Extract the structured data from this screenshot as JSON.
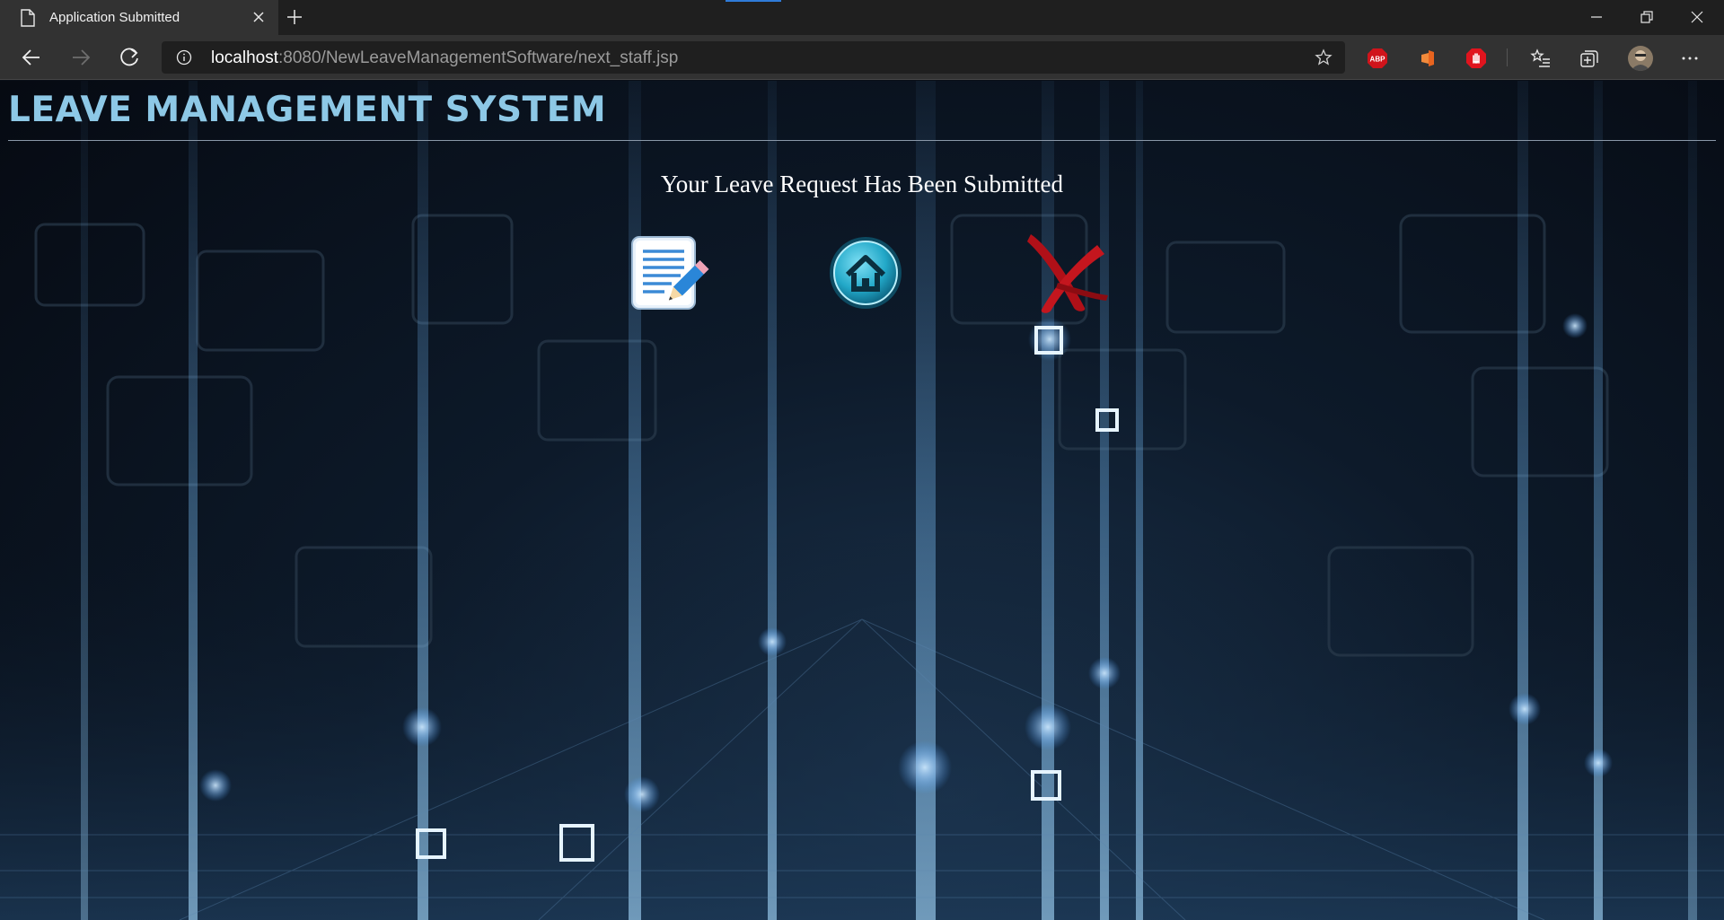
{
  "browser": {
    "tab_title": "Application Submitted",
    "url_host": "localhost",
    "url_path": ":8080/NewLeaveManagementSoftware/next_staff.jsp",
    "extensions": {
      "adblock_label": "ABP"
    }
  },
  "page": {
    "site_title": "LEAVE MANAGEMENT SYSTEM",
    "message": "Your Leave Request Has Been Submitted",
    "actions": [
      {
        "icon": "edit-document-icon"
      },
      {
        "icon": "home-icon"
      },
      {
        "icon": "close-x-icon"
      }
    ]
  },
  "colors": {
    "title_color": "#8dc8e6",
    "chrome_dark": "#1f1f1f",
    "chrome_mid": "#323232",
    "close_red": "#b01018",
    "home_teal": "#22a8c8"
  }
}
